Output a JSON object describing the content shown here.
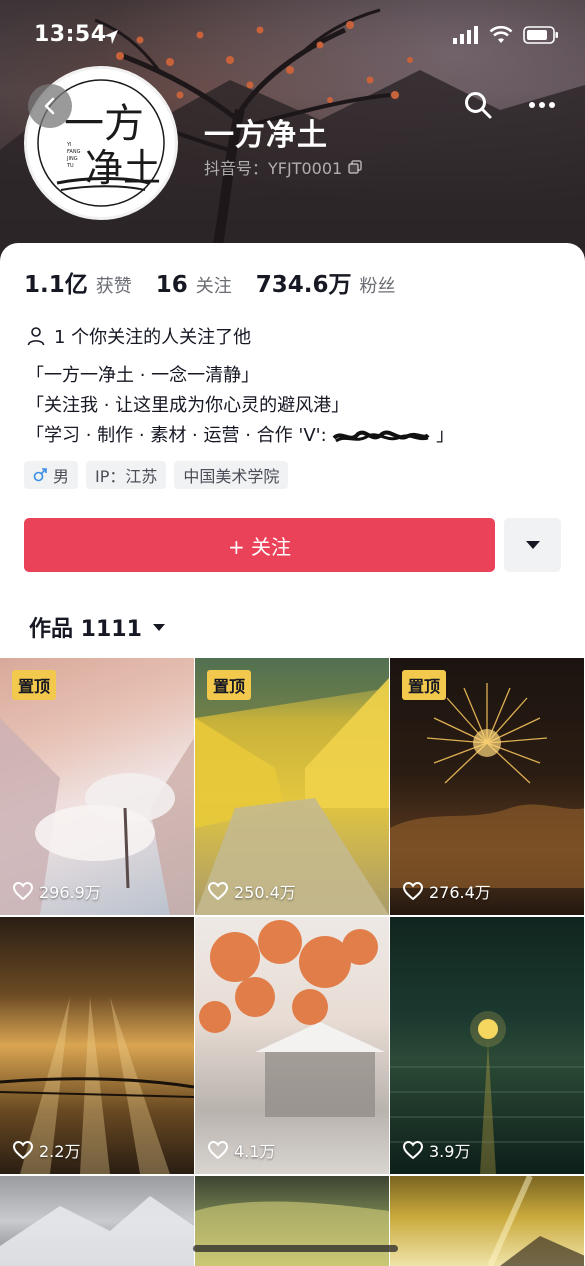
{
  "status_bar": {
    "time": "13:54"
  },
  "profile": {
    "name": "一方净土",
    "account_id": "抖音号：YFJT0001",
    "avatar_logo_text": "一方净土",
    "avatar_logo_pinyin": [
      "YI",
      "FANG",
      "JING",
      "TU"
    ]
  },
  "stats": [
    {
      "value": "1.1亿",
      "label": "获赞"
    },
    {
      "value": "16",
      "label": "关注"
    },
    {
      "value": "734.6万",
      "label": "粉丝"
    }
  ],
  "mutual_follow": "1 个你关注的人关注了他",
  "bio": [
    "「一方一净土 · 一念一清静」",
    "「关注我 · 让这里成为你心灵的避风港」",
    "「学习 · 制作 · 素材 · 运营 · 合作 'V':"
  ],
  "bio_tail": "」",
  "tags": [
    {
      "icon": "male-icon",
      "text": "男"
    },
    {
      "text": "IP：江苏"
    },
    {
      "text": "中国美术学院"
    }
  ],
  "actions": {
    "follow_label": "+ 关注"
  },
  "works_tab": {
    "label": "作品 1111"
  },
  "grid": {
    "pin_label": "置顶",
    "items": [
      {
        "likes": "296.9万",
        "pinned": true
      },
      {
        "likes": "250.4万",
        "pinned": true
      },
      {
        "likes": "276.4万",
        "pinned": true
      },
      {
        "likes": "2.2万",
        "pinned": false
      },
      {
        "likes": "4.1万",
        "pinned": false
      },
      {
        "likes": "3.9万",
        "pinned": false
      }
    ]
  },
  "colors": {
    "follow_button": "#ea4359",
    "pin_badge": "#f2c94c",
    "text_primary": "#161823",
    "text_secondary": "#6b6d74"
  }
}
